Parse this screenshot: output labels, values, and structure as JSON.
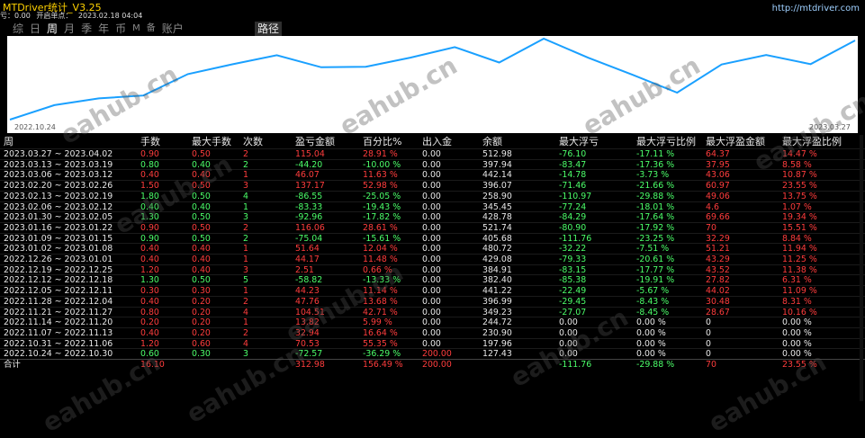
{
  "app_title": "MTDriver统计_V3.25",
  "url": "http://mtdriver.com",
  "subinfo": [
    "亏：0.00",
    "开启单点：",
    "2023.02.18 04:04"
  ],
  "nav": [
    "综",
    "日",
    "周",
    "月",
    "季",
    "年",
    "币",
    "M",
    "备",
    "账户"
  ],
  "nav_active": "周",
  "path_button": "路径",
  "chart": {
    "line_color": "#1aa0ff",
    "start_date": "2022.10.24",
    "end_date": "2023.03.27",
    "balance": [
      127.43,
      197.96,
      230.9,
      244.72,
      349.23,
      396.99,
      441.22,
      382.4,
      384.91,
      429.08,
      480.72,
      405.68,
      521.74,
      428.78,
      345.45,
      258.9,
      396.07,
      442.14,
      397.94,
      512.98
    ]
  },
  "headers": [
    "周",
    "手数",
    "最大手数",
    "次数",
    "盈亏金额",
    "百分比%",
    "出入金",
    "余额",
    "最大浮亏",
    "最大浮亏比例",
    "最大浮盈金额",
    "最大浮盈比例"
  ],
  "rows": [
    {
      "period": "2023.03.27 ~ 2023.04.02",
      "lots": "0.90",
      "maxlots": "0.50",
      "count": "2",
      "pnl": "115.04",
      "pct": "28.91 %",
      "io": "0.00",
      "bal": "512.98",
      "mfl": "-76.10",
      "mflp": "-17.11 %",
      "mfp": "64.37",
      "mfpp": "14.47 %"
    },
    {
      "period": "2023.03.13 ~ 2023.03.19",
      "lots": "0.80",
      "maxlots": "0.40",
      "count": "2",
      "pnl": "-44.20",
      "pct": "-10.00 %",
      "io": "0.00",
      "bal": "397.94",
      "mfl": "-83.47",
      "mflp": "-17.36 %",
      "mfp": "37.95",
      "mfpp": "8.58 %"
    },
    {
      "period": "2023.03.06 ~ 2023.03.12",
      "lots": "0.40",
      "maxlots": "0.40",
      "count": "1",
      "pnl": "46.07",
      "pct": "11.63 %",
      "io": "0.00",
      "bal": "442.14",
      "mfl": "-14.78",
      "mflp": "-3.73 %",
      "mfp": "43.06",
      "mfpp": "10.87 %"
    },
    {
      "period": "2023.02.20 ~ 2023.02.26",
      "lots": "1.50",
      "maxlots": "0.50",
      "count": "3",
      "pnl": "137.17",
      "pct": "52.98 %",
      "io": "0.00",
      "bal": "396.07",
      "mfl": "-71.46",
      "mflp": "-21.66 %",
      "mfp": "60.97",
      "mfpp": "23.55 %"
    },
    {
      "period": "2023.02.13 ~ 2023.02.19",
      "lots": "1.80",
      "maxlots": "0.50",
      "count": "4",
      "pnl": "-86.55",
      "pct": "-25.05 %",
      "io": "0.00",
      "bal": "258.90",
      "mfl": "-110.97",
      "mflp": "-29.88 %",
      "mfp": "49.06",
      "mfpp": "13.75 %"
    },
    {
      "period": "2023.02.06 ~ 2023.02.12",
      "lots": "0.40",
      "maxlots": "0.40",
      "count": "1",
      "pnl": "-83.33",
      "pct": "-19.43 %",
      "io": "0.00",
      "bal": "345.45",
      "mfl": "-77.24",
      "mflp": "-18.01 %",
      "mfp": "4.6",
      "mfpp": "1.07 %"
    },
    {
      "period": "2023.01.30 ~ 2023.02.05",
      "lots": "1.30",
      "maxlots": "0.50",
      "count": "3",
      "pnl": "-92.96",
      "pct": "-17.82 %",
      "io": "0.00",
      "bal": "428.78",
      "mfl": "-84.29",
      "mflp": "-17.64 %",
      "mfp": "69.66",
      "mfpp": "19.34 %"
    },
    {
      "period": "2023.01.16 ~ 2023.01.22",
      "lots": "0.90",
      "maxlots": "0.50",
      "count": "2",
      "pnl": "116.06",
      "pct": "28.61 %",
      "io": "0.00",
      "bal": "521.74",
      "mfl": "-80.90",
      "mflp": "-17.92 %",
      "mfp": "70",
      "mfpp": "15.51 %"
    },
    {
      "period": "2023.01.09 ~ 2023.01.15",
      "lots": "0.90",
      "maxlots": "0.50",
      "count": "2",
      "pnl": "-75.04",
      "pct": "-15.61 %",
      "io": "0.00",
      "bal": "405.68",
      "mfl": "-111.76",
      "mflp": "-23.25 %",
      "mfp": "32.29",
      "mfpp": "8.84 %"
    },
    {
      "period": "2023.01.02 ~ 2023.01.08",
      "lots": "0.40",
      "maxlots": "0.40",
      "count": "1",
      "pnl": "51.64",
      "pct": "12.04 %",
      "io": "0.00",
      "bal": "480.72",
      "mfl": "-32.22",
      "mflp": "-7.51 %",
      "mfp": "51.21",
      "mfpp": "11.94 %"
    },
    {
      "period": "2022.12.26 ~ 2023.01.01",
      "lots": "0.40",
      "maxlots": "0.40",
      "count": "1",
      "pnl": "44.17",
      "pct": "11.48 %",
      "io": "0.00",
      "bal": "429.08",
      "mfl": "-79.33",
      "mflp": "-20.61 %",
      "mfp": "43.29",
      "mfpp": "11.25 %"
    },
    {
      "period": "2022.12.19 ~ 2022.12.25",
      "lots": "1.20",
      "maxlots": "0.40",
      "count": "3",
      "pnl": "2.51",
      "pct": "0.66 %",
      "io": "0.00",
      "bal": "384.91",
      "mfl": "-83.15",
      "mflp": "-17.77 %",
      "mfp": "43.52",
      "mfpp": "11.38 %"
    },
    {
      "period": "2022.12.12 ~ 2022.12.18",
      "lots": "1.30",
      "maxlots": "0.50",
      "count": "5",
      "pnl": "-58.82",
      "pct": "-13.33 %",
      "io": "0.00",
      "bal": "382.40",
      "mfl": "-85.38",
      "mflp": "-19.91 %",
      "mfp": "27.82",
      "mfpp": "6.31 %"
    },
    {
      "period": "2022.12.05 ~ 2022.12.11",
      "lots": "0.30",
      "maxlots": "0.30",
      "count": "1",
      "pnl": "44.23",
      "pct": "11.14 %",
      "io": "0.00",
      "bal": "441.22",
      "mfl": "-22.49",
      "mflp": "-5.67 %",
      "mfp": "44.02",
      "mfpp": "11.09 %"
    },
    {
      "period": "2022.11.28 ~ 2022.12.04",
      "lots": "0.40",
      "maxlots": "0.20",
      "count": "2",
      "pnl": "47.76",
      "pct": "13.68 %",
      "io": "0.00",
      "bal": "396.99",
      "mfl": "-29.45",
      "mflp": "-8.43 %",
      "mfp": "30.48",
      "mfpp": "8.31 %"
    },
    {
      "period": "2022.11.21 ~ 2022.11.27",
      "lots": "0.80",
      "maxlots": "0.20",
      "count": "4",
      "pnl": "104.51",
      "pct": "42.71 %",
      "io": "0.00",
      "bal": "349.23",
      "mfl": "-27.07",
      "mflp": "-8.45 %",
      "mfp": "28.67",
      "mfpp": "10.16 %"
    },
    {
      "period": "2022.11.14 ~ 2022.11.20",
      "lots": "0.20",
      "maxlots": "0.20",
      "count": "1",
      "pnl": "13.82",
      "pct": "5.99 %",
      "io": "0.00",
      "bal": "244.72",
      "mfl": "0.00",
      "mflp": "0.00 %",
      "mfp": "0",
      "mfpp": "0.00 %"
    },
    {
      "period": "2022.11.07 ~ 2022.11.13",
      "lots": "0.40",
      "maxlots": "0.20",
      "count": "2",
      "pnl": "32.94",
      "pct": "16.64 %",
      "io": "0.00",
      "bal": "230.90",
      "mfl": "0.00",
      "mflp": "0.00 %",
      "mfp": "0",
      "mfpp": "0.00 %"
    },
    {
      "period": "2022.10.31 ~ 2022.11.06",
      "lots": "1.20",
      "maxlots": "0.60",
      "count": "4",
      "pnl": "70.53",
      "pct": "55.35 %",
      "io": "0.00",
      "bal": "197.96",
      "mfl": "0.00",
      "mflp": "0.00 %",
      "mfp": "0",
      "mfpp": "0.00 %"
    },
    {
      "period": "2022.10.24 ~ 2022.10.30",
      "lots": "0.60",
      "maxlots": "0.30",
      "count": "3",
      "pnl": "-72.57",
      "pct": "-36.29 %",
      "io": "200.00",
      "bal": "127.43",
      "mfl": "0.00",
      "mflp": "0.00 %",
      "mfp": "0",
      "mfpp": "0.00 %"
    }
  ],
  "total": {
    "period": "合计",
    "lots": "16.10",
    "maxlots": "",
    "count": "",
    "pnl": "312.98",
    "pct": "156.49 %",
    "io": "200.00",
    "bal": "",
    "mfl": "-111.76",
    "mflp": "-29.88 %",
    "mfp": "70",
    "mfpp": "23.55 %"
  },
  "watermark": "eahub.cn"
}
